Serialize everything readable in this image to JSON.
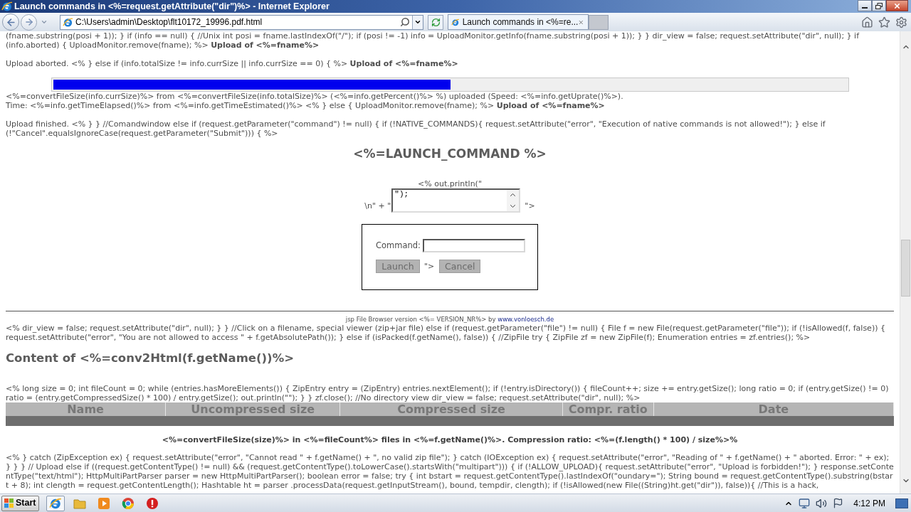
{
  "window": {
    "title": "Launch commands in <%=request.getAttribute(\"dir\")%> - Internet Explorer"
  },
  "toolbar": {
    "address": "C:\\Users\\admin\\Desktop\\flt10172_19996.pdf.html",
    "tabs": [
      {
        "label": "Launch commands in <%=re...",
        "selected": true
      }
    ]
  },
  "content": [
    {
      "kind": "para",
      "text": "(fname.substring(posi + 1)); } if (info == null) { //Unix int posi = fname.lastIndexOf(\"/\"); if (posi != -1) info = UploadMonitor.getInfo(fname.substring(posi + 1)); } } dir_view = false; request.setAttribute(\"dir\", null); } if (info.aborted) { UploadMonitor.remove(fname); %> **Upload of <%=fname%>**"
    },
    {
      "kind": "para",
      "text": "Upload aborted. <% } else if (info.totalSize != info.currSize || info.currSize == 0) { %> **Upload of <%=fname%>**"
    },
    {
      "kind": "progress",
      "level": 0.5
    },
    {
      "kind": "line",
      "text": "<%=convertFileSize(info.currSize)%> from <%=convertFileSize(info.totalSize)%> (<%=info.getPercent()%> %) uploaded (Speed: <%=info.getUprate()%>)."
    },
    {
      "kind": "para",
      "text": "Time: <%=info.getTimeElapsed()%> from <%=info.getTimeEstimated()%> <% } else { UploadMonitor.remove(fname); %> **Upload of <%=fname%>**"
    },
    {
      "kind": "para",
      "text": "Upload finished. <% } } //Comandwindow else if (request.getParameter(\"command\") != null) { if (!NATIVE_COMMANDS){ request.setAttribute(\"error\", \"Execution of native commands is not allowed!\"); } else if (!\"Cancel\".equalsIgnoreCase(request.getParameter(\"Submit\"))) { %>"
    },
    {
      "kind": "heading",
      "text": "<%=LAUNCH_COMMAND %>"
    },
    {
      "kind": "prompt",
      "caption": "<% out.println(\"",
      "prefix": "\\n\" + \"",
      "value": "\");",
      "suffix": "\">"
    },
    {
      "kind": "form",
      "label": "Command:",
      "buttons": [
        "Launch",
        "Cancel"
      ],
      "separator": "\">"
    },
    {
      "kind": "footer",
      "text": "jsp File Browser version <%= VERSION_NR%> by",
      "link": "www.vonloesch.de"
    },
    {
      "kind": "line",
      "text": "<% dir_view = false; request.setAttribute(\"dir\", null); } } //Click on a filename, special viewer (zip+jar file) else if (request.getParameter(\"file\") != null) { File f = new File(request.getParameter(\"file\")); if (!isAllowed(f, false)) { request.setAttribute(\"error\", \"You are not allowed to access \" + f.getAbsolutePath()); } else if (isPacked(f.getName(), false)) { //ZipFile try { ZipFile zf = new ZipFile(f); Enumeration entries = zf.entries(); %>"
    },
    {
      "kind": "title",
      "text": "Content of <%=conv2Html(f.getName())%>"
    },
    {
      "kind": "line",
      "text": "<% long size = 0; int fileCount = 0; while (entries.hasMoreElements()) { ZipEntry entry = (ZipEntry) entries.nextElement(); if (!entry.isDirectory()) { fileCount++; size += entry.getSize(); long ratio = 0; if (entry.getSize() != 0) ratio = (entry.getCompressedSize() * 100) / entry.getSize(); out.println(\"\"); } } zf.close(); //No directory view dir_view = false; request.setAttribute(\"dir\", null); %>"
    },
    {
      "kind": "table",
      "columns": [
        "Name",
        "Uncompressed size",
        "Compressed size",
        "Compr. ratio",
        "Date"
      ]
    },
    {
      "kind": "summary",
      "text": "<%=convertFileSize(size)%> in <%=fileCount%> files in <%=f.getName()%>. Compression ratio: <%=(f.length() * 100) / size%>%"
    },
    {
      "kind": "clipped",
      "text": "<% } catch (ZipException ex) { request.setAttribute(\"error\", \"Cannot read \" + f.getName() + \", no valid zip file\"); } catch (IOException ex) { request.setAttribute(\"error\", \"Reading of \" + f.getName() + \" aborted. Error: \" + ex); } } } // Upload else if ((request.getContentType() != null) && (request.getContentType().toLowerCase().startsWith(\"multipart\"))) { if (!ALLOW_UPLOAD){ request.setAttribute(\"error\", \"Upload is forbidden!\"); } response.setContentType(\"text/html\"); HttpMultiPartParser parser = new HttpMultiPartParser(); boolean error = false; try { int bstart = request.getContentType().lastIndexOf(\"oundary=\"); String bound = request.getContentType().substring(bstart + 8); int clength = request.getContentLength(); Hashtable ht = parser .processData(request.getInputStream(), bound, tempdir, clength); if (!isAllowed(new File((String)ht.get(\"dir\")), false)){ //This is a hack,"
    }
  ],
  "taskbar": {
    "start": "Start",
    "apps": [
      {
        "kind": "browser",
        "selected": true
      },
      {
        "kind": "folder",
        "selected": false
      },
      {
        "kind": "player",
        "selected": false
      },
      {
        "kind": "globe",
        "selected": false
      },
      {
        "kind": "alert",
        "selected": false
      }
    ],
    "clock": "4:12 PM"
  }
}
